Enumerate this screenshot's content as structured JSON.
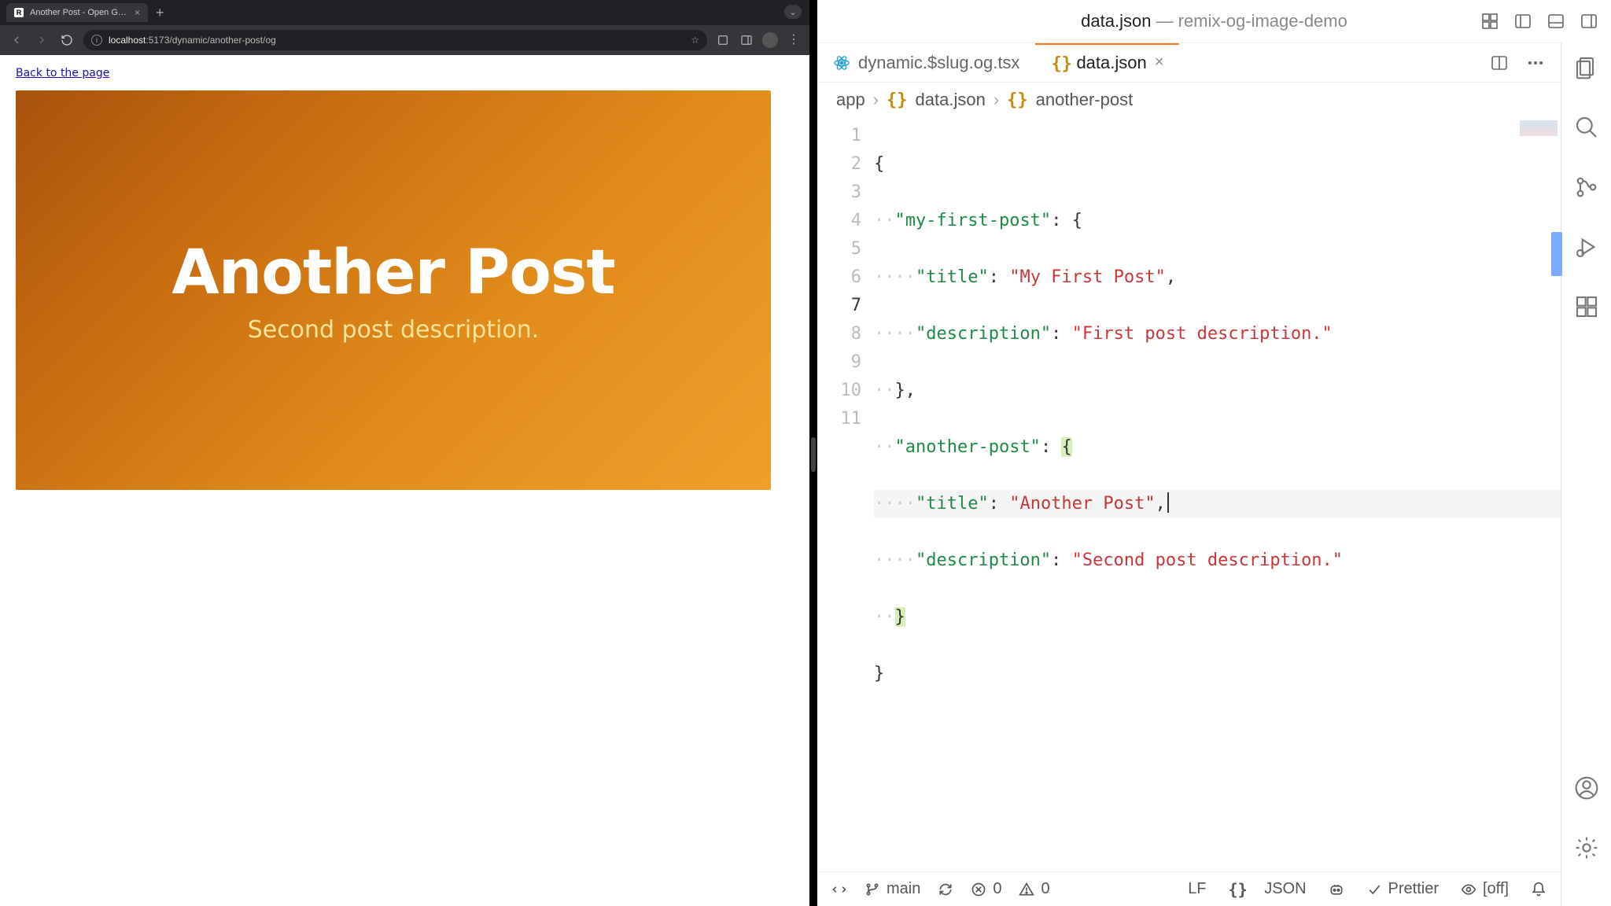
{
  "browser": {
    "tab": {
      "favicon_letter": "R",
      "title": "Another Post - Open Graph I…"
    },
    "url_host": "localhost",
    "url_port_path": ":5173/dynamic/another-post/og",
    "back_link": "Back to the page",
    "og_title": "Another Post",
    "og_desc": "Second post description."
  },
  "vscode": {
    "window_title_main": "data.json",
    "window_title_project": "remix-og-image-demo",
    "tabs": [
      {
        "label": "dynamic.$slug.og.tsx",
        "active": false
      },
      {
        "label": "data.json",
        "active": true
      }
    ],
    "breadcrumb": {
      "root": "app",
      "file": "data.json",
      "node": "another-post"
    },
    "line_numbers": [
      "1",
      "2",
      "3",
      "4",
      "5",
      "6",
      "7",
      "8",
      "9",
      "10",
      "11"
    ],
    "current_line_number": "7",
    "code": {
      "my_first_post_key": "\"my-first-post\"",
      "title_key": "\"title\"",
      "description_key": "\"description\"",
      "my_first_post_title_val": "\"My First Post\"",
      "my_first_post_desc_val": "\"First post description.\"",
      "another_post_key": "\"another-post\"",
      "another_post_title_val": "\"Another Post\"",
      "another_post_desc_val": "\"Second post description.\""
    },
    "statusbar": {
      "branch": "main",
      "errors": "0",
      "warnings": "0",
      "eol": "LF",
      "lang": "JSON",
      "formatter": "Prettier",
      "screencast": "[off]"
    }
  }
}
